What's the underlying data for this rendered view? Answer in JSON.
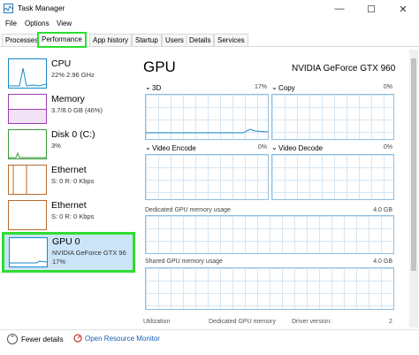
{
  "window": {
    "title": "Task Manager",
    "controls": [
      "—",
      "☐",
      "✕"
    ]
  },
  "menu": [
    "File",
    "Options",
    "View"
  ],
  "tabs": [
    {
      "label": "Processes"
    },
    {
      "label": "Performance"
    },
    {
      "label": "App history"
    },
    {
      "label": "Startup"
    },
    {
      "label": "Users"
    },
    {
      "label": "Details"
    },
    {
      "label": "Services"
    }
  ],
  "sidebar": {
    "cpu": {
      "name": "CPU",
      "sub": "22%  2.96 GHz"
    },
    "memory": {
      "name": "Memory",
      "sub": "3.7/8.0 GB (46%)"
    },
    "disk": {
      "name": "Disk 0 (C:)",
      "sub": "3%"
    },
    "eth1": {
      "name": "Ethernet",
      "sub": "S: 0  R: 0 Kbps"
    },
    "eth2": {
      "name": "Ethernet",
      "sub": "S: 0  R: 0 Kbps"
    },
    "gpu": {
      "name": "GPU 0",
      "sub1": "NVIDIA GeForce GTX 96",
      "sub2": "17%"
    }
  },
  "main": {
    "title": "GPU",
    "model": "NVIDIA GeForce GTX 960",
    "panels": {
      "p3d": {
        "label": "3D",
        "pct": "17%"
      },
      "copy": {
        "label": "Copy",
        "pct": "0%"
      },
      "venc": {
        "label": "Video Encode",
        "pct": "0%"
      },
      "vdec": {
        "label": "Video Decode",
        "pct": "0%"
      }
    },
    "dedicated": {
      "label": "Dedicated GPU memory usage",
      "max": "4.0 GB"
    },
    "shared": {
      "label": "Shared GPU memory usage",
      "max": "4.0 GB"
    },
    "stats": {
      "utilization": "Utilization",
      "dedicated": "Dedicated GPU memory",
      "driver": "Driver version:",
      "driver_value": "2"
    }
  },
  "bottom": {
    "fewer": "Fewer details",
    "orm": "Open Resource Monitor"
  },
  "colors": {
    "accent_green": "#2fdd32",
    "graph_blue": "#8dbde1",
    "select_bg": "#cce4f7"
  }
}
